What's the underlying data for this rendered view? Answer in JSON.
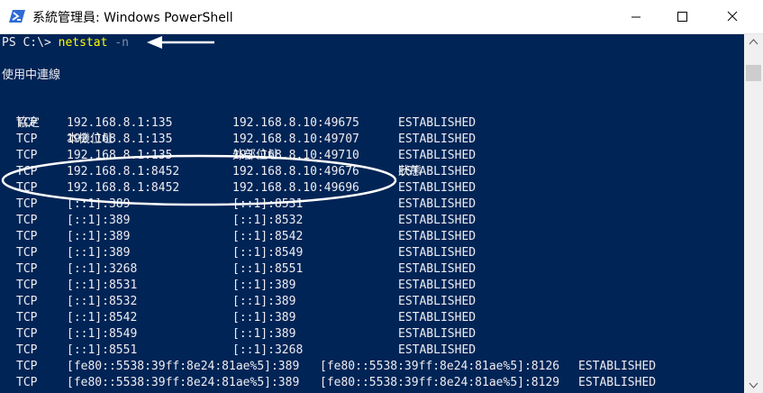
{
  "window": {
    "title": "系統管理員: Windows PowerShell",
    "app_icon": "powershell-icon",
    "controls": [
      "minimize-icon",
      "maximize-icon",
      "close-icon"
    ]
  },
  "colors": {
    "background": "#012456",
    "text": "#eeedf0",
    "command": "#ffff00",
    "argument": "#7f8fa8",
    "annotation": "#ffffff"
  },
  "console": {
    "prompt": "PS C:\\> ",
    "command": "netstat",
    "argument": " -n",
    "section_title": "使用中連線",
    "headers": [
      "協定",
      "本機位址",
      "外部位址",
      "狀態"
    ],
    "rows": [
      [
        "TCP",
        "192.168.8.1:135",
        "192.168.8.10:49675",
        "ESTABLISHED"
      ],
      [
        "TCP",
        "192.168.8.1:135",
        "192.168.8.10:49707",
        "ESTABLISHED"
      ],
      [
        "TCP",
        "192.168.8.1:135",
        "192.168.8.10:49710",
        "ESTABLISHED"
      ],
      [
        "TCP",
        "192.168.8.1:8452",
        "192.168.8.10:49676",
        "ESTABLISHED"
      ],
      [
        "TCP",
        "192.168.8.1:8452",
        "192.168.8.10:49696",
        "ESTABLISHED"
      ],
      [
        "TCP",
        "[::1]:389",
        "[::1]:8531",
        "ESTABLISHED"
      ],
      [
        "TCP",
        "[::1]:389",
        "[::1]:8532",
        "ESTABLISHED"
      ],
      [
        "TCP",
        "[::1]:389",
        "[::1]:8542",
        "ESTABLISHED"
      ],
      [
        "TCP",
        "[::1]:389",
        "[::1]:8549",
        "ESTABLISHED"
      ],
      [
        "TCP",
        "[::1]:3268",
        "[::1]:8551",
        "ESTABLISHED"
      ],
      [
        "TCP",
        "[::1]:8531",
        "[::1]:389",
        "ESTABLISHED"
      ],
      [
        "TCP",
        "[::1]:8532",
        "[::1]:389",
        "ESTABLISHED"
      ],
      [
        "TCP",
        "[::1]:8542",
        "[::1]:389",
        "ESTABLISHED"
      ],
      [
        "TCP",
        "[::1]:8549",
        "[::1]:389",
        "ESTABLISHED"
      ],
      [
        "TCP",
        "[::1]:8551",
        "[::1]:3268",
        "ESTABLISHED"
      ],
      [
        "TCP",
        "[fe80::5538:39ff:8e24:81ae%5]:389",
        "[fe80::5538:39ff:8e24:81ae%5]:8126",
        "ESTABLISHED"
      ],
      [
        "TCP",
        "[fe80::5538:39ff:8e24:81ae%5]:389",
        "[fe80::5538:39ff:8e24:81ae%5]:8129",
        "ESTABLISHED"
      ]
    ]
  },
  "annotations": {
    "arrow": "arrow-pointing-to-command",
    "highlight": "ellipse-around-8452-rows"
  }
}
